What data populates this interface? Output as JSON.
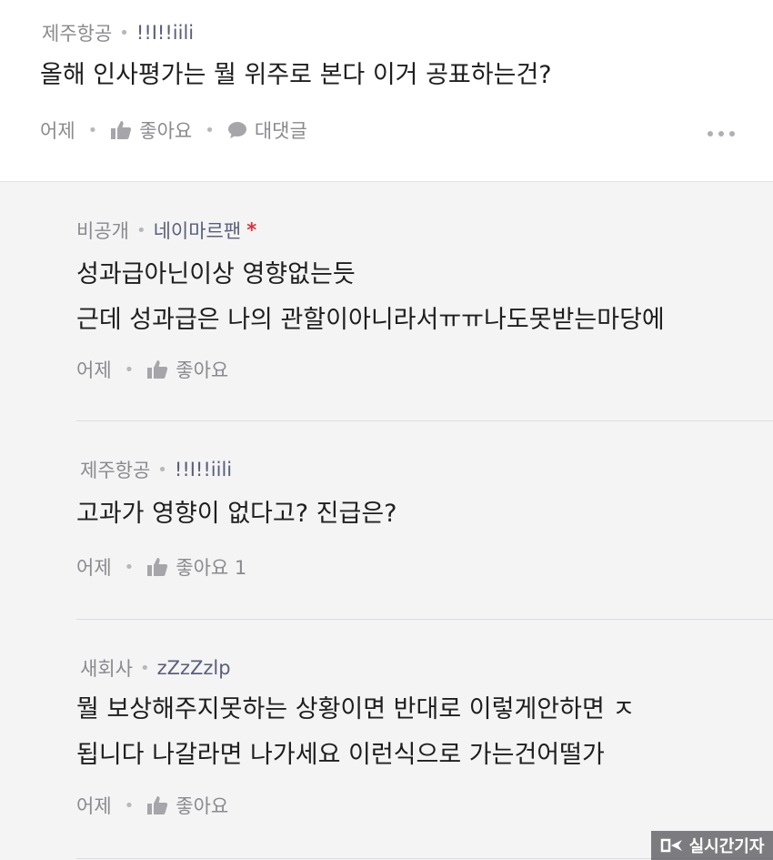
{
  "main_comment": {
    "company": "제주항공",
    "nickname": "!!I!!iili",
    "text": "올해 인사평가는 뭘 위주로 본다 이거 공표하는건?",
    "time": "어제",
    "like_label": "좋아요",
    "reply_label": "대댓글"
  },
  "replies": [
    {
      "company": "비공개",
      "nickname": "네이마르팬",
      "author_mark": "*",
      "lines": [
        "성과급아닌이상 영향없는듯",
        "근데 성과급은 나의 관할이아니라서ㅠㅠ나도못받는마당에"
      ],
      "time": "어제",
      "like_label": "좋아요"
    },
    {
      "company": "제주항공",
      "nickname": "!!I!!iili",
      "lines": [
        "고과가 영향이 없다고? 진급은?"
      ],
      "time": "어제",
      "like_label": "좋아요 1"
    },
    {
      "company": "새회사",
      "nickname": "zZzZzlp",
      "lines": [
        "뭘 보상해주지못하는 상황이면 반대로 이렇게안하면 ㅈ",
        "됩니다 나갈라면 나가세요 이런식으로 가는건어떨가"
      ],
      "time": "어제",
      "like_label": "좋아요"
    }
  ],
  "watermark": "실시간기자",
  "icons": {
    "like": "thumbs-up-icon",
    "reply": "speech-bubble-icon",
    "more": "more-dots-icon"
  },
  "colors": {
    "top_background": "#ffffff",
    "reply_background": "#f4f4f5",
    "author_mark": "#e0323a",
    "nickname": "#5a5f7a"
  }
}
